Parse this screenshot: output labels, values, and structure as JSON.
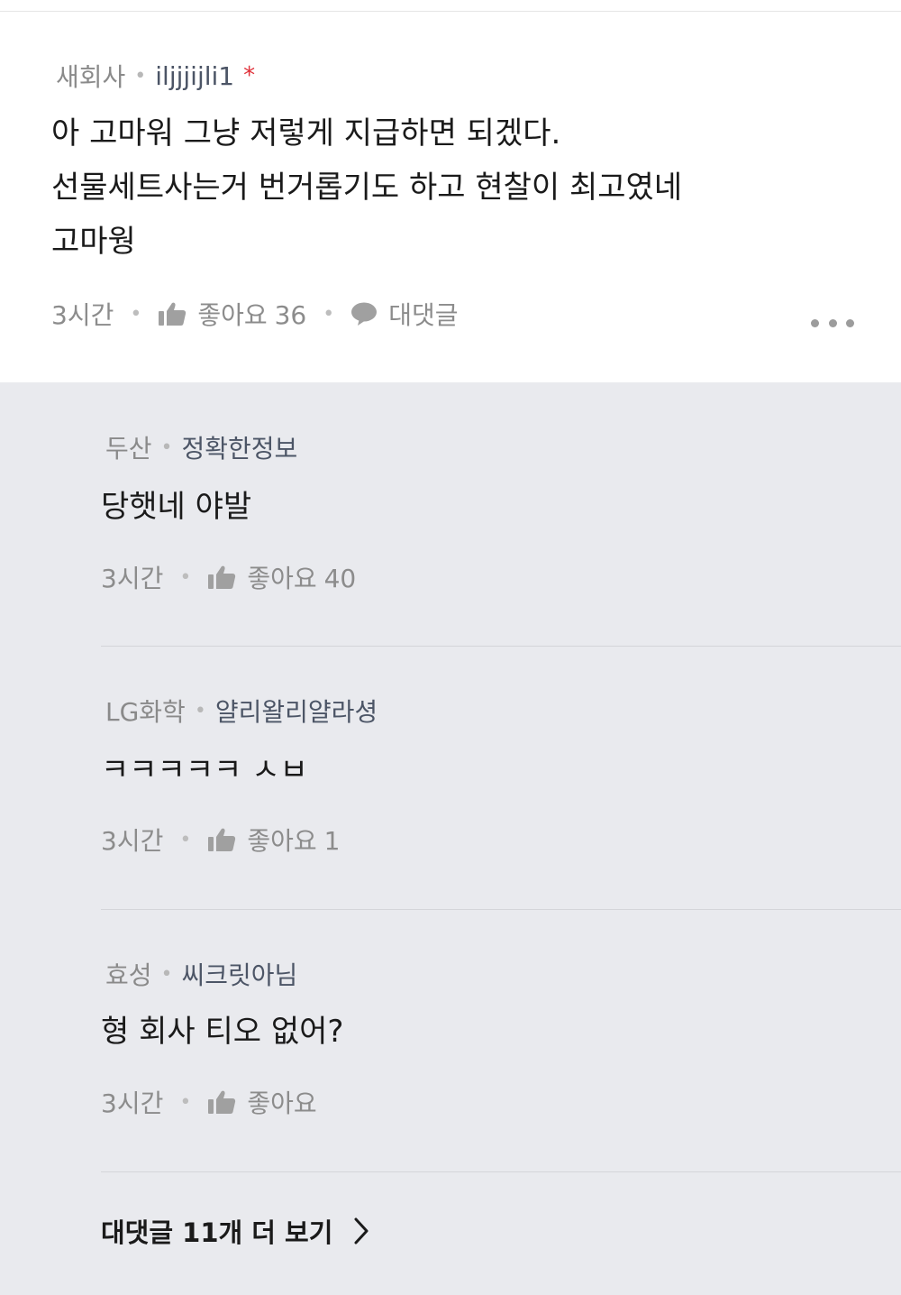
{
  "main_comment": {
    "company": "새회사",
    "nickname": "iljjjijli1",
    "badge": "*",
    "lines": [
      "아 고마워 그냥 저렇게 지급하면 되겠다.",
      "선물세트사는거 번거롭기도 하고 현찰이 최고였네",
      "고마웡"
    ],
    "time": "3시간",
    "like_label": "좋아요",
    "like_count": "36",
    "reply_label": "대댓글",
    "more_icon": "more-horizontal-icon"
  },
  "replies": [
    {
      "company": "두산",
      "nickname": "정확한정보",
      "text": "당햇네 야발",
      "time": "3시간",
      "like_label": "좋아요",
      "like_count": "40"
    },
    {
      "company": "LG화학",
      "nickname": "얄리왈리얄라셩",
      "text": "ㅋㅋㅋㅋㅋ ㅅㅂ",
      "time": "3시간",
      "like_label": "좋아요",
      "like_count": "1"
    },
    {
      "company": "효성",
      "nickname": "씨크릿아님",
      "text": "형 회사 티오 없어?",
      "time": "3시간",
      "like_label": "좋아요",
      "like_count": ""
    }
  ],
  "more_replies": {
    "label": "대댓글 11개 더 보기"
  },
  "icons": {
    "like": "thumbs-up-icon",
    "reply": "speech-bubble-icon",
    "chevron": "chevron-right-icon"
  },
  "colors": {
    "nickname": "#4c5566",
    "meta": "#8a8a8a",
    "star": "#e0323b",
    "reply_bg": "#e9eaee"
  }
}
